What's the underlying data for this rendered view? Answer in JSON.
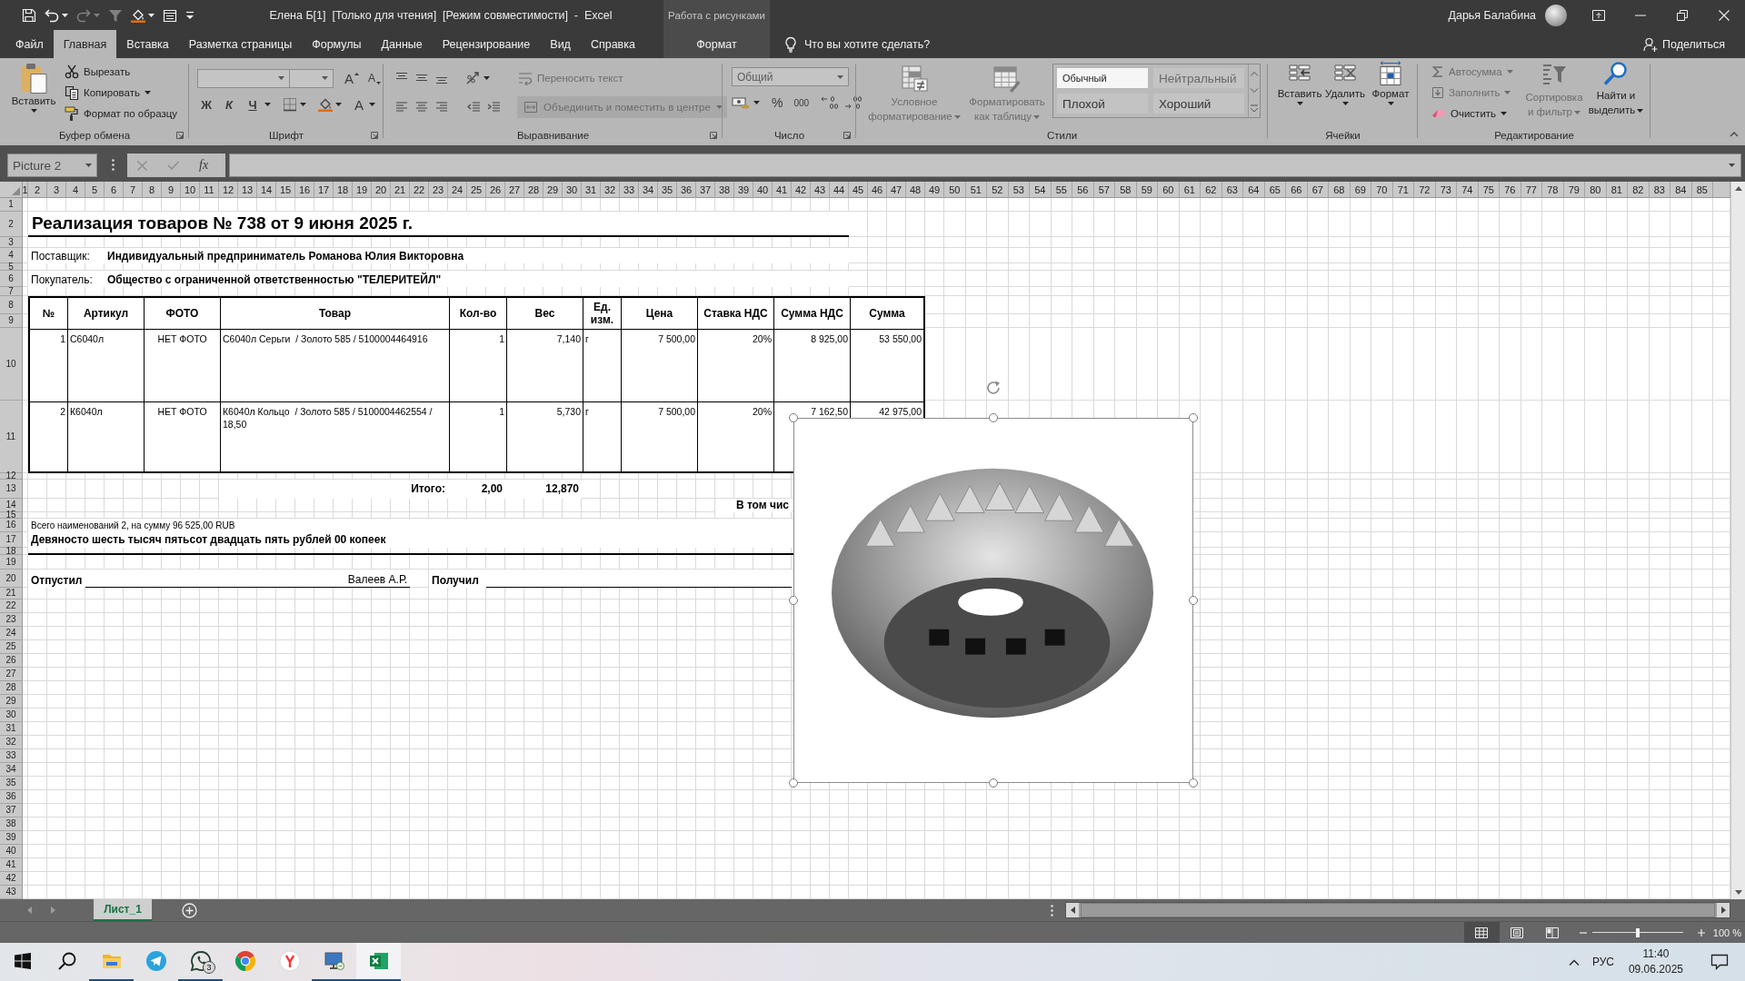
{
  "title_bar": {
    "quick_access": [
      {
        "kind": "save",
        "disabled": false
      },
      {
        "kind": "undo",
        "disabled": false
      },
      {
        "kind": "redo",
        "disabled": true
      },
      {
        "kind": "filter",
        "disabled": true
      },
      {
        "kind": "fill_color",
        "disabled": false
      },
      {
        "kind": "form",
        "disabled": false
      },
      {
        "kind": "customize",
        "disabled": false
      }
    ],
    "title": "Елена Б[1]  [Только для чтения]  [Режим совместимости]  -  Excel",
    "context_header": "Работа с рисунками",
    "user": "Дарья Балабина"
  },
  "tabs": [
    {
      "label": "Файл",
      "kind": "standard",
      "selected": false
    },
    {
      "label": "Главная",
      "kind": "standard",
      "selected": true
    },
    {
      "label": "Вставка",
      "kind": "standard",
      "selected": false
    },
    {
      "label": "Разметка страницы",
      "kind": "standard",
      "selected": false
    },
    {
      "label": "Формулы",
      "kind": "standard",
      "selected": false
    },
    {
      "label": "Данные",
      "kind": "standard",
      "selected": false
    },
    {
      "label": "Рецензирование",
      "kind": "standard",
      "selected": false
    },
    {
      "label": "Вид",
      "kind": "standard",
      "selected": false
    },
    {
      "label": "Справка",
      "kind": "standard",
      "selected": false
    },
    {
      "label": "Формат",
      "kind": "contextual",
      "selected": false
    }
  ],
  "tell_me": {
    "placeholder": "Что вы хотите сделать?"
  },
  "share": "Поделиться",
  "ribbon": {
    "clipboard": {
      "label": "Буфер обмена",
      "paste": {
        "label": "Вставить",
        "disabled": false
      },
      "buttons": [
        {
          "kind": "cut",
          "label": "Вырезать",
          "disabled": false
        },
        {
          "kind": "copy",
          "label": "Копировать",
          "disabled": false
        },
        {
          "kind": "format_painter",
          "label": "Формат по образцу",
          "disabled": false
        }
      ]
    },
    "font": {
      "label": "Шрифт",
      "size_buttons": [
        {
          "kind": "grow",
          "label": "A"
        },
        {
          "kind": "shrink",
          "label": "A"
        }
      ],
      "style_buttons": [
        {
          "kind": "bold",
          "label": "Ж"
        },
        {
          "kind": "italic",
          "label": "К"
        },
        {
          "kind": "underline",
          "label": "Ч"
        }
      ],
      "color_button": "A"
    },
    "alignment": {
      "label": "Выравнивание",
      "wrap": {
        "label": "Переносить текст",
        "disabled": true
      },
      "merge": {
        "label": "Объединить и поместить в центре",
        "disabled": true
      }
    },
    "number": {
      "label": "Число",
      "format": {
        "value": "Общий",
        "disabled": true
      },
      "buttons": [
        {
          "kind": "percent",
          "label": "%"
        },
        {
          "kind": "thousands",
          "label": "000"
        }
      ]
    },
    "styles": {
      "label": "Стили",
      "buttons": [
        {
          "kind": "conditional",
          "lines": [
            "Условное",
            "форматирование"
          ],
          "disabled": true
        },
        {
          "kind": "table",
          "lines": [
            "Форматировать",
            "как таблицу"
          ],
          "disabled": true
        }
      ],
      "gallery": [
        {
          "kind": "normal",
          "label": "Обычный",
          "selected": true
        },
        {
          "kind": "neutral",
          "label": "Нейтральный",
          "selected": false
        },
        {
          "kind": "bad",
          "label": "Плохой",
          "selected": false
        },
        {
          "kind": "good",
          "label": "Хороший",
          "selected": false
        }
      ]
    },
    "cells": {
      "label": "Ячейки",
      "buttons": [
        {
          "kind": "insert",
          "label": "Вставить",
          "disabled": false
        },
        {
          "kind": "delete",
          "label": "Удалить",
          "disabled": false
        },
        {
          "kind": "format",
          "label": "Формат",
          "disabled": false
        }
      ]
    },
    "editing": {
      "label": "Редактирование",
      "small": [
        {
          "kind": "autosum",
          "label": "Автосумма",
          "disabled": true
        },
        {
          "kind": "fill",
          "label": "Заполнить",
          "disabled": true
        },
        {
          "kind": "clear",
          "label": "Очистить",
          "disabled": false
        }
      ],
      "big": [
        {
          "kind": "sort",
          "lines": [
            "Сортировка",
            "и фильтр"
          ],
          "disabled": true
        },
        {
          "kind": "find",
          "lines": [
            "Найти и",
            "выделить"
          ],
          "disabled": false
        }
      ]
    }
  },
  "formula_bar": {
    "name_box": "Picture 2",
    "function_button": "fx"
  },
  "sheet": {
    "column_headers": [
      "1",
      "2",
      "3",
      "4",
      "5",
      "6",
      "7",
      "8",
      "9",
      "10",
      "11",
      "12",
      "13",
      "14",
      "15",
      "16",
      "17",
      "18",
      "19",
      "20",
      "21",
      "22",
      "23",
      "24",
      "25",
      "26",
      "27",
      "28",
      "29",
      "30",
      "31",
      "32",
      "33",
      "34",
      "35",
      "36",
      "37",
      "38",
      "39",
      "40",
      "41",
      "42",
      "43",
      "44",
      "45",
      "46",
      "47",
      "48",
      "49",
      "50",
      "51",
      "52",
      "53",
      "54",
      "55",
      "56",
      "57",
      "58",
      "59",
      "60",
      "61",
      "62",
      "63",
      "64",
      "65",
      "66",
      "67",
      "68",
      "69",
      "70",
      "71",
      "72",
      "73",
      "74",
      "75",
      "76",
      "77",
      "78",
      "79",
      "80",
      "81",
      "82",
      "83",
      "84",
      "85"
    ],
    "row_headers": [
      "1",
      "2",
      "3",
      "4",
      "5",
      "6",
      "7",
      "8",
      "9",
      "10",
      "11",
      "12",
      "13",
      "14",
      "15",
      "16",
      "17",
      "18",
      "19",
      "20",
      "21",
      "22",
      "23",
      "24",
      "25",
      "26",
      "27",
      "28",
      "29",
      "30",
      "31",
      "32",
      "33",
      "34",
      "35",
      "36",
      "37",
      "38",
      "39",
      "40",
      "41",
      "42",
      "43"
    ],
    "document": {
      "title": "Реализация товаров № 738 от 9 июня 2025 г.",
      "parties": [
        {
          "label": "Поставщик:",
          "value": "Индивидуальный предприниматель Романова Юлия Викторовна"
        },
        {
          "label": "Покупатель:",
          "value": "Общество с ограниченной ответственностью \"ТЕЛЕРИТЕЙЛ\""
        }
      ],
      "table": {
        "columns": [
          "№",
          "Артикул",
          "ФОТО",
          "Товар",
          "Кол-во",
          "Вес",
          "Ед. изм.",
          "Цена",
          "Ставка НДС",
          "Сумма НДС",
          "Сумма"
        ],
        "rows": [
          [
            "1",
            "С6040л",
            "НЕТ ФОТО",
            "С6040л Серьги  / Золото 585 / 5100004464916",
            "1",
            "7,140",
            "г",
            "7 500,00",
            "20%",
            "8 925,00",
            "53 550,00"
          ],
          [
            "2",
            "К6040л",
            "НЕТ ФОТО",
            "К6040л Кольцо  / Золото 585 / 5100004462554 / 18,50",
            "1",
            "5,730",
            "г",
            "7 500,00",
            "20%",
            "7 162,50",
            "42 975,00"
          ]
        ]
      },
      "totals": {
        "label": "Итого:",
        "quantity": "2,00",
        "weight": "12,870"
      },
      "vat_note": "В том чис",
      "summary": "Всего наименований 2, на сумму 96 525,00 RUB",
      "amount_in_words": "Девяносто шесть тысяч пятьсот двадцать пять рублей 00 копеек",
      "signatures": {
        "released_label": "Отпустил",
        "released_name": "Валеев А.Р.",
        "received_label": "Получил"
      }
    },
    "picture": {
      "selected": true
    }
  },
  "sheet_tabs": [
    {
      "label": "Лист_1",
      "selected": true
    }
  ],
  "status_bar": {
    "views": [
      {
        "kind": "normal",
        "selected": true
      },
      {
        "kind": "page_layout",
        "selected": false
      },
      {
        "kind": "page_break",
        "selected": false
      }
    ],
    "zoom": {
      "level": 0.5,
      "label": "100 %"
    }
  },
  "taskbar": {
    "apps": [
      {
        "kind": "explorer",
        "running": true,
        "selected": false
      },
      {
        "kind": "telegram",
        "running": false,
        "selected": false
      },
      {
        "kind": "whatsapp",
        "running": true,
        "selected": false,
        "badge": "3"
      },
      {
        "kind": "chrome",
        "running": false,
        "selected": false
      },
      {
        "kind": "yandex",
        "running": false,
        "selected": false
      },
      {
        "kind": "remote_desktop",
        "running": true,
        "selected": false
      },
      {
        "kind": "excel",
        "running": true,
        "selected": true
      }
    ],
    "language": "РУС",
    "time": "11:40",
    "date": "09.06.2025"
  }
}
